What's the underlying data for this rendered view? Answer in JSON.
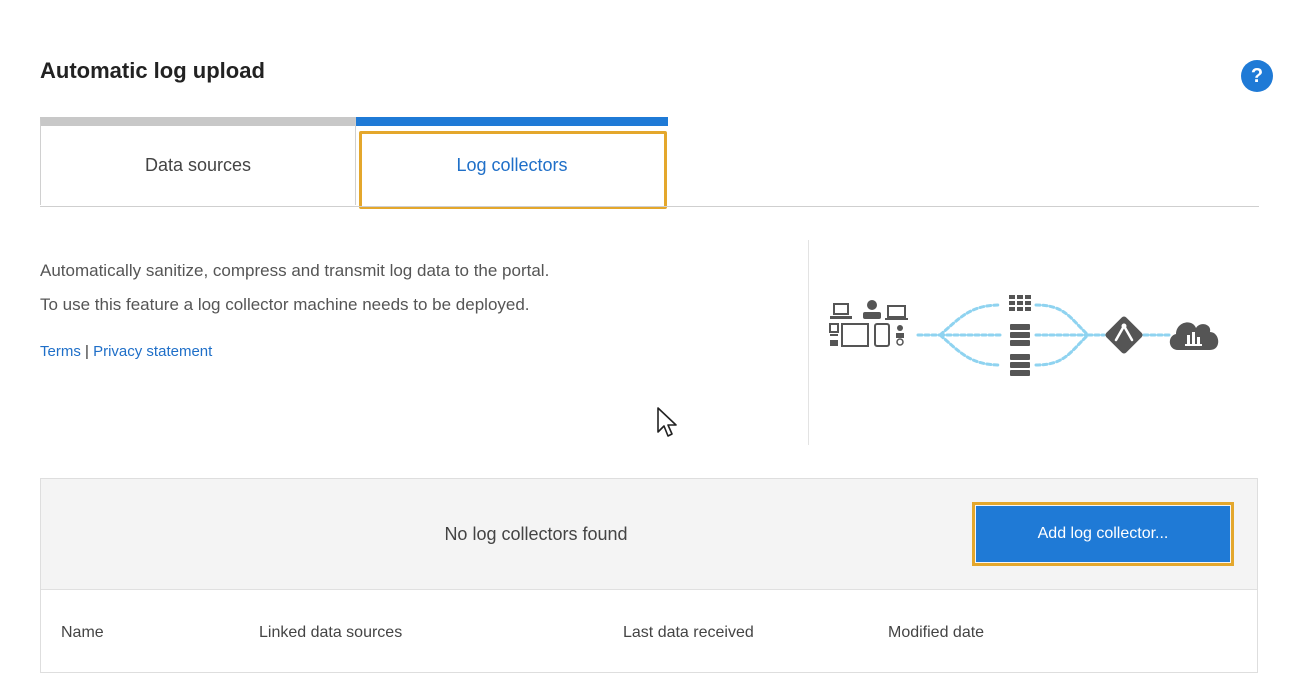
{
  "header": {
    "title": "Automatic log upload",
    "help_icon": "question-mark-icon",
    "help_symbol": "?"
  },
  "tabs": [
    {
      "label": "Data sources",
      "active": false
    },
    {
      "label": "Log collectors",
      "active": true
    }
  ],
  "description": {
    "line1": "Automatically sanitize, compress and transmit log data to the portal.",
    "line2": "To use this feature a log collector machine needs to be deployed.",
    "terms_link": "Terms",
    "separator": "|",
    "privacy_link": "Privacy statement"
  },
  "collectors_panel": {
    "empty_message": "No log collectors found",
    "add_button": "Add log collector...",
    "columns": [
      "Name",
      "Linked data sources",
      "Last data received",
      "Modified date"
    ]
  },
  "colors": {
    "accent": "#1f7ad6",
    "highlight": "#e4a72c",
    "diagram_flow": "#8fd3f0",
    "diagram_icons": "#555555"
  }
}
